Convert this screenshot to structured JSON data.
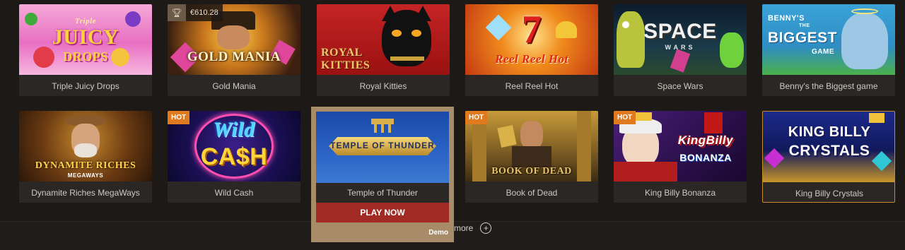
{
  "games_row1": [
    {
      "name": "Triple Juicy Drops",
      "art": {
        "line1": "Triple",
        "line2": "JUICY",
        "line3": "DROPS"
      }
    },
    {
      "name": "Gold Mania",
      "jackpot": "€610.28",
      "art": {
        "line1": "GOLD MANIA"
      }
    },
    {
      "name": "Royal Kitties",
      "art": {
        "line1": "ROYAL",
        "line2": "KITTIES"
      }
    },
    {
      "name": "Reel Reel Hot",
      "art": {
        "line1": "7",
        "line2": "Reel Reel Hot"
      }
    },
    {
      "name": "Space Wars",
      "art": {
        "line1": "SPACE",
        "line2": "WARS"
      }
    },
    {
      "name": "Benny's the Biggest game",
      "art": {
        "line1": "BENNY'S",
        "line2": "THE",
        "line3": "BIGGEST",
        "line4": "GAME"
      }
    }
  ],
  "games_row2": [
    {
      "name": "Dynamite Riches MegaWays",
      "art": {
        "line1": "DYNAMITE RICHES",
        "line2": "MEGAWAYS"
      }
    },
    {
      "name": "Wild Cash",
      "badge": "HOT",
      "art": {
        "line1": "Wild",
        "line2": "CA$H"
      }
    },
    {
      "name": "Book of Dead",
      "badge": "HOT",
      "art": {
        "line1": "BOOK OF DEAD"
      }
    },
    {
      "name": "King Billy Bonanza",
      "badge": "HOT",
      "art": {
        "line1": "KingBilly",
        "line2": "BONANZA"
      }
    },
    {
      "name": "King Billy Crystals",
      "art": {
        "line1": "KING BILLY",
        "line2": "CRYSTALS"
      }
    }
  ],
  "hover_game": {
    "name": "Temple of Thunder",
    "art": {
      "line1": "TEMPLE OF THUNDER"
    },
    "play_label": "PLAY NOW",
    "demo_label": "Demo"
  },
  "load_more": {
    "label": "more",
    "icon": "plus-circle-icon"
  }
}
